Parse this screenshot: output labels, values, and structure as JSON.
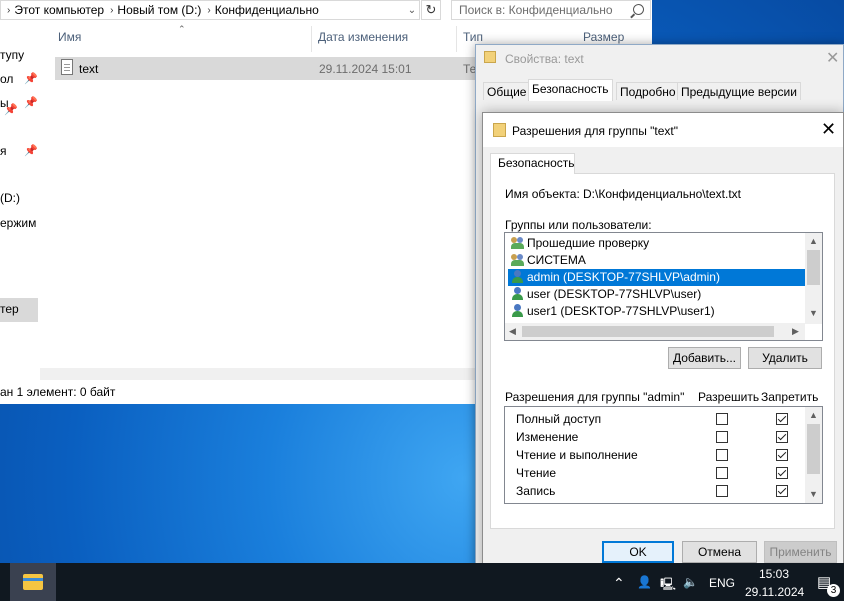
{
  "explorer": {
    "breadcrumb": [
      "Этот компьютер",
      "Новый том (D:)",
      "Конфиденциально"
    ],
    "search_placeholder": "Поиск в: Конфиденциально",
    "nav_items": [
      "тупу",
      "ол",
      "ы",
      "я",
      "(D:)",
      "ержим",
      "тер"
    ],
    "columns": {
      "name": "Имя",
      "date": "Дата изменения",
      "type": "Тип",
      "size": "Размер"
    },
    "file": {
      "name": "text",
      "date": "29.11.2024 15:01",
      "type": "Те"
    },
    "status": "ан 1 элемент: 0 байт"
  },
  "properties": {
    "title": "Свойства: text",
    "tabs": [
      "Общие",
      "Безопасность",
      "Подробно",
      "Предыдущие версии"
    ]
  },
  "dialog": {
    "title": "Разрешения для группы \"text\"",
    "tab": "Безопасность",
    "object_label": "Имя объекта:",
    "object_value": "D:\\Конфиденциально\\text.txt",
    "groups_label": "Группы или пользователи:",
    "users": [
      {
        "name": "Прошедшие проверку",
        "icon": "group-icon",
        "selected": false
      },
      {
        "name": "СИСТЕМА",
        "icon": "group-icon",
        "selected": false
      },
      {
        "name": "admin (DESKTOP-77SHLVP\\admin)",
        "icon": "user-icon",
        "selected": true
      },
      {
        "name": "user (DESKTOP-77SHLVP\\user)",
        "icon": "user-icon",
        "selected": false
      },
      {
        "name": "user1 (DESKTOP-77SHLVP\\user1)",
        "icon": "user-icon",
        "selected": false
      }
    ],
    "add_label": "Добавить...",
    "remove_label": "Удалить",
    "perm_header": "Разрешения для группы \"admin\"",
    "allow_header": "Разрешить",
    "deny_header": "Запретить",
    "permissions": [
      {
        "name": "Полный доступ",
        "allow": false,
        "deny": true
      },
      {
        "name": "Изменение",
        "allow": false,
        "deny": true
      },
      {
        "name": "Чтение и выполнение",
        "allow": false,
        "deny": true
      },
      {
        "name": "Чтение",
        "allow": false,
        "deny": true
      },
      {
        "name": "Запись",
        "allow": false,
        "deny": true
      }
    ],
    "ok_label": "OK",
    "cancel_label": "Отмена",
    "apply_label": "Применить"
  },
  "taskbar": {
    "lang": "ENG",
    "time": "15:03",
    "date": "29.11.2024",
    "notification_count": "3"
  },
  "colors": {
    "selection": "#0078d7",
    "taskbar": "#101820"
  }
}
